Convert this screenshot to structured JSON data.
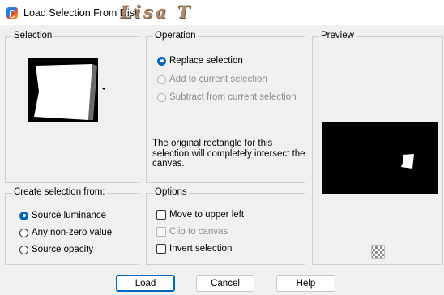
{
  "window": {
    "title": "Load Selection From Disk",
    "watermark": "Lisa T"
  },
  "selection_group": {
    "label": "Selection"
  },
  "operation_group": {
    "label": "Operation",
    "options": [
      {
        "label": "Replace selection",
        "checked": true,
        "enabled": true
      },
      {
        "label": "Add to current selection",
        "checked": false,
        "enabled": false
      },
      {
        "label": "Subtract from current selection",
        "checked": false,
        "enabled": false
      }
    ],
    "info": "The original rectangle for this selection will completely intersect the canvas."
  },
  "preview_group": {
    "label": "Preview"
  },
  "create_group": {
    "label": "Create selection from:",
    "options": [
      {
        "label": "Source luminance",
        "checked": true
      },
      {
        "label": "Any non-zero value",
        "checked": false
      },
      {
        "label": "Source opacity",
        "checked": false
      }
    ]
  },
  "options_group": {
    "label": "Options",
    "checks": [
      {
        "label": "Move to upper left",
        "checked": false,
        "enabled": true
      },
      {
        "label": "Clip to canvas",
        "checked": false,
        "enabled": false
      },
      {
        "label": "Invert selection",
        "checked": false,
        "enabled": true
      }
    ]
  },
  "buttons": {
    "load": "Load",
    "cancel": "Cancel",
    "help": "Help"
  },
  "colors": {
    "accent": "#0067c0",
    "watermark": "#a37f5e"
  }
}
